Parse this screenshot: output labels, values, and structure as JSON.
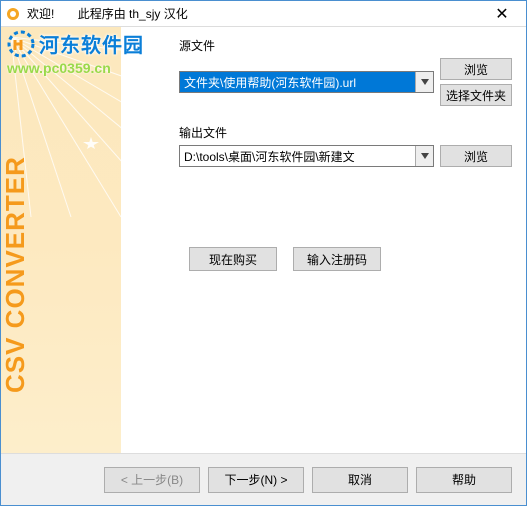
{
  "titlebar": {
    "welcome": "欢迎!",
    "subtitle": "此程序由 th_sjy 汉化"
  },
  "watermark": {
    "text": "河东软件园",
    "url": "www.pc0359.cn"
  },
  "sidebar": {
    "title": "CSV CONVERTER"
  },
  "form": {
    "source_label": "源文件",
    "source_value": "文件夹\\使用帮助(河东软件园).url",
    "browse": "浏览",
    "select_folder": "选择文件夹",
    "output_label": "输出文件",
    "output_value": "D:\\tools\\桌面\\河东软件园\\新建文"
  },
  "actions": {
    "buy_now": "现在购买",
    "enter_code": "输入注册码"
  },
  "footer": {
    "back": "< 上一步(B)",
    "next": "下一步(N) >",
    "cancel": "取消",
    "help": "帮助"
  }
}
